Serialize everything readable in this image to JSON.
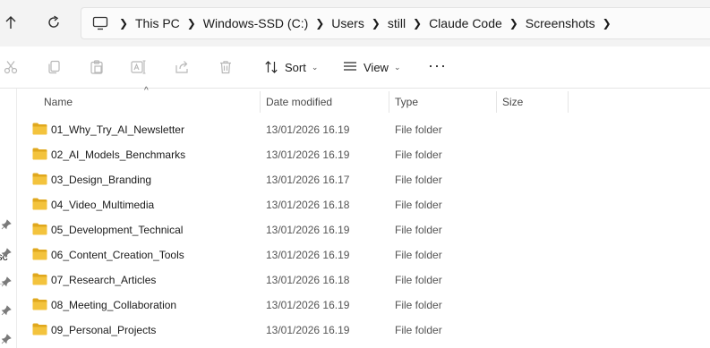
{
  "address_bar": {
    "breadcrumbs": [
      "This PC",
      "Windows-SSD (C:)",
      "Users",
      "still",
      "Claude Code",
      "Screenshots"
    ]
  },
  "toolbar": {
    "sort_label": "Sort",
    "view_label": "View",
    "more_label": "···"
  },
  "left_pane": {
    "partial_text": "ersc"
  },
  "columns": {
    "name": "Name",
    "date_modified": "Date modified",
    "type": "Type",
    "size": "Size"
  },
  "rows": [
    {
      "name": "01_Why_Try_AI_Newsletter",
      "date": "13/01/2026 16.19",
      "type": "File folder"
    },
    {
      "name": "02_AI_Models_Benchmarks",
      "date": "13/01/2026 16.19",
      "type": "File folder"
    },
    {
      "name": "03_Design_Branding",
      "date": "13/01/2026 16.17",
      "type": "File folder"
    },
    {
      "name": "04_Video_Multimedia",
      "date": "13/01/2026 16.18",
      "type": "File folder"
    },
    {
      "name": "05_Development_Technical",
      "date": "13/01/2026 16.19",
      "type": "File folder"
    },
    {
      "name": "06_Content_Creation_Tools",
      "date": "13/01/2026 16.19",
      "type": "File folder"
    },
    {
      "name": "07_Research_Articles",
      "date": "13/01/2026 16.18",
      "type": "File folder"
    },
    {
      "name": "08_Meeting_Collaboration",
      "date": "13/01/2026 16.19",
      "type": "File folder"
    },
    {
      "name": "09_Personal_Projects",
      "date": "13/01/2026 16.19",
      "type": "File folder"
    }
  ],
  "colors": {
    "folder": "#f3c33d",
    "folder_dark": "#e0a81e",
    "background": "#ffffff",
    "address_bg": "#f3f3f3"
  },
  "icons": [
    "up-arrow-icon",
    "refresh-icon",
    "this-pc-icon",
    "cut-icon",
    "copy-icon",
    "paste-icon",
    "rename-icon",
    "share-icon",
    "delete-icon",
    "sort-icon",
    "view-icon",
    "more-icon",
    "pin-icon",
    "folder-icon"
  ]
}
